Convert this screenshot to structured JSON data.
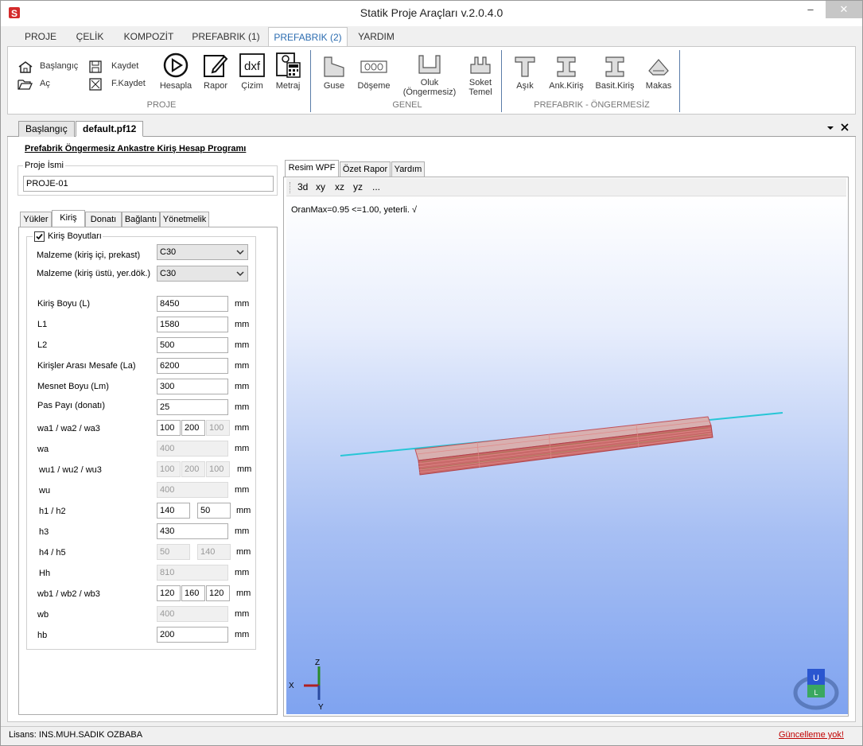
{
  "window": {
    "title": "Statik Proje Araçları v.2.0.4.0",
    "min": "–",
    "max": "□",
    "close": "✕"
  },
  "menu": [
    "PROJE",
    "ÇELİK",
    "KOMPOZİT",
    "PREFABRIK (1)",
    "PREFABRIK (2)",
    "YARDIM"
  ],
  "ribbon": {
    "proje": {
      "baslangic": "Başlangıç",
      "ac": "Aç",
      "kaydet": "Kaydet",
      "fkaydet": "F.Kaydet",
      "hesapla": "Hesapla",
      "rapor": "Rapor",
      "cizim": "Çizim",
      "metraj": "Metraj",
      "dxf": "dxf",
      "label": "PROJE"
    },
    "genel": {
      "guse": "Guse",
      "doseme": "Döşeme",
      "oluk1": "Oluk",
      "oluk2": "(Öngermesiz)",
      "soket1": "Soket",
      "soket2": "Temel",
      "label": "GENEL"
    },
    "prefabrik": {
      "asik": "Aşık",
      "ank": "Ank.Kiriş",
      "basit": "Basit.Kiriş",
      "makas": "Makas",
      "label": "PREFABRIK - ÖNGERMESİZ"
    }
  },
  "doctabs": {
    "tab1": "Başlangıç",
    "tab2": "default.pf12"
  },
  "panel": {
    "title": "Prefabrik Öngermesiz Ankastre Kiriş Hesap Programı",
    "proje_isim_legend": "Proje İsmi",
    "proje_isim": "PROJE-01",
    "tabs": [
      "Yükler",
      "Kiriş",
      "Donatı",
      "Bağlantı",
      "Yönetmelik"
    ],
    "kiris_boyutlari": "Kiriş Boyutları",
    "malzeme1_label": "Malzeme (kiriş içi, prekast)",
    "malzeme1": "C30",
    "malzeme2_label": "Malzeme (kiriş üstü, yer.dök.)",
    "malzeme2": "C30",
    "unit": "mm",
    "fields": {
      "L": {
        "label": "Kiriş Boyu (L)",
        "value": "8450"
      },
      "L1": {
        "label": "L1",
        "value": "1580"
      },
      "L2": {
        "label": "L2",
        "value": "500"
      },
      "La": {
        "label": "Kirişler Arası Mesafe (La)",
        "value": "6200"
      },
      "Lm": {
        "label": "Mesnet Boyu (Lm)",
        "value": "300"
      },
      "pas": {
        "label": "Pas Payı (donatı)",
        "value": "25"
      },
      "wa123": {
        "label": "wa1 / wa2 / wa3",
        "v1": "100",
        "v2": "200",
        "v3": "100"
      },
      "wa": {
        "label": "wa",
        "value": "400"
      },
      "wu123": {
        "label": "wu1 / wu2 / wu3",
        "v1": "100",
        "v2": "200",
        "v3": "100"
      },
      "wu": {
        "label": "wu",
        "value": "400"
      },
      "h12": {
        "label": "h1 / h2",
        "v1": "140",
        "v2": "50"
      },
      "h3": {
        "label": "h3",
        "value": "430"
      },
      "h45": {
        "label": "h4 / h5",
        "v1": "50",
        "v2": "140"
      },
      "Hh": {
        "label": "Hh",
        "value": "810"
      },
      "wb123": {
        "label": "wb1 / wb2 / wb3",
        "v1": "120",
        "v2": "160",
        "v3": "120"
      },
      "wb": {
        "label": "wb",
        "value": "400"
      },
      "hb": {
        "label": "hb",
        "value": "200"
      }
    }
  },
  "right": {
    "tabs": [
      "Resim WPF",
      "Özet Rapor",
      "Yardım"
    ],
    "toolbar": [
      "3d",
      "xy",
      "xz",
      "yz",
      "..."
    ],
    "oran": "OranMax=0.95 <=1.00, yeterli. √",
    "axes": {
      "x": "X",
      "y": "Y",
      "z": "Z"
    },
    "cube": {
      "top": "U",
      "front": "L"
    }
  },
  "status": {
    "lisans": "Lisans: INS.MUH.SADIK OZBABA",
    "guncelleme": "Güncelleme yok!"
  },
  "colors": {
    "accent": "#2b6cb0",
    "beam": "#c0505a",
    "rebar": "#27c6d6",
    "link_red": "#c00000"
  }
}
